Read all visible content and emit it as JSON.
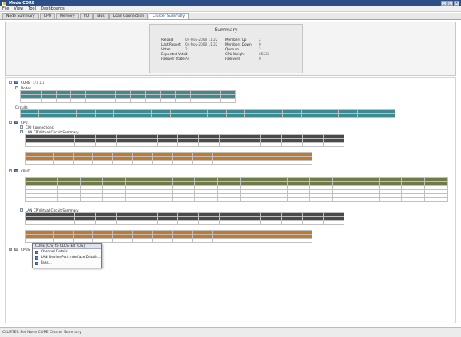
{
  "window": {
    "title": "Mode CORE"
  },
  "menu": [
    "File",
    "View",
    "Tool",
    "Dashboards"
  ],
  "tabs": [
    "Node Summary",
    "CPU",
    "Memory",
    "I/O",
    "Bus",
    "Load Connection",
    "Cluster Summary"
  ],
  "summary": {
    "title": "Summary",
    "rows": [
      {
        "k1": "Reload",
        "v1": "04-Nov-2008 11:22",
        "k2": "Members Up",
        "v2": "2"
      },
      {
        "k1": "Last Report",
        "v1": "04-Nov-2008 11:22",
        "k2": "Members Down",
        "v2": "0"
      },
      {
        "k1": "Votes",
        "v1": "2",
        "k2": "Quorum",
        "v2": "2"
      },
      {
        "k1": "Expected Votes",
        "v1": "2",
        "k2": "CPU Weight",
        "v2": "65535"
      },
      {
        "k1": "Failover State",
        "v1": "All",
        "k2": "Failovers",
        "v2": "0"
      }
    ]
  },
  "tree": {
    "root": {
      "label": "CORE",
      "extra": "1/1   1/1"
    },
    "nodes": [
      {
        "label": "Nodes"
      },
      {
        "label": "Circuits"
      },
      {
        "label": "CPU"
      },
      {
        "label": "CIO Connections"
      },
      {
        "label": "LAN CP Virtual Circuit Summary"
      },
      {
        "label": "CPUD"
      },
      {
        "label": "LAN CP Virtual Circuit Summary"
      },
      {
        "label": "CPUS"
      }
    ]
  },
  "context_menu": {
    "header": "CORE   [CIS] to CLUSTER [CIS]",
    "items": [
      "Channel Details...",
      "LAN Device/Port Interface Details...",
      "Fans..."
    ]
  },
  "statusbar": {
    "text": "CLUSTER Set Node CORE   Cluster Summary"
  }
}
